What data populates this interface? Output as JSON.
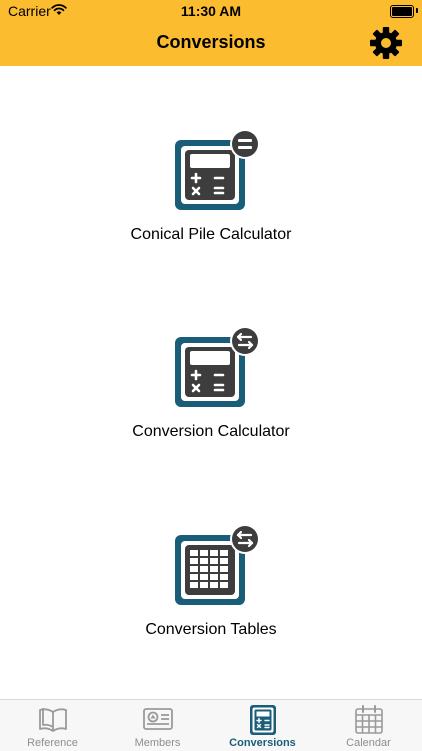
{
  "status_bar": {
    "carrier": "Carrier",
    "time": "11:30 AM"
  },
  "header": {
    "title": "Conversions",
    "settings_icon": "gear-icon"
  },
  "tools": [
    {
      "label": "Conical Pile Calculator",
      "icon": "calculator-equals-icon"
    },
    {
      "label": "Conversion Calculator",
      "icon": "calculator-arrows-icon"
    },
    {
      "label": "Conversion Tables",
      "icon": "table-arrows-icon"
    }
  ],
  "tabs": [
    {
      "label": "Reference",
      "icon": "book-icon",
      "active": false
    },
    {
      "label": "Members",
      "icon": "member-card-icon",
      "active": false
    },
    {
      "label": "Conversions",
      "icon": "calculator-icon",
      "active": true
    },
    {
      "label": "Calendar",
      "icon": "calendar-icon",
      "active": false
    }
  ],
  "colors": {
    "header": "#fcbc2f",
    "accent": "#1a5d79",
    "icon_dark": "#3d3d3d",
    "tab_inactive": "#8e8e93"
  }
}
